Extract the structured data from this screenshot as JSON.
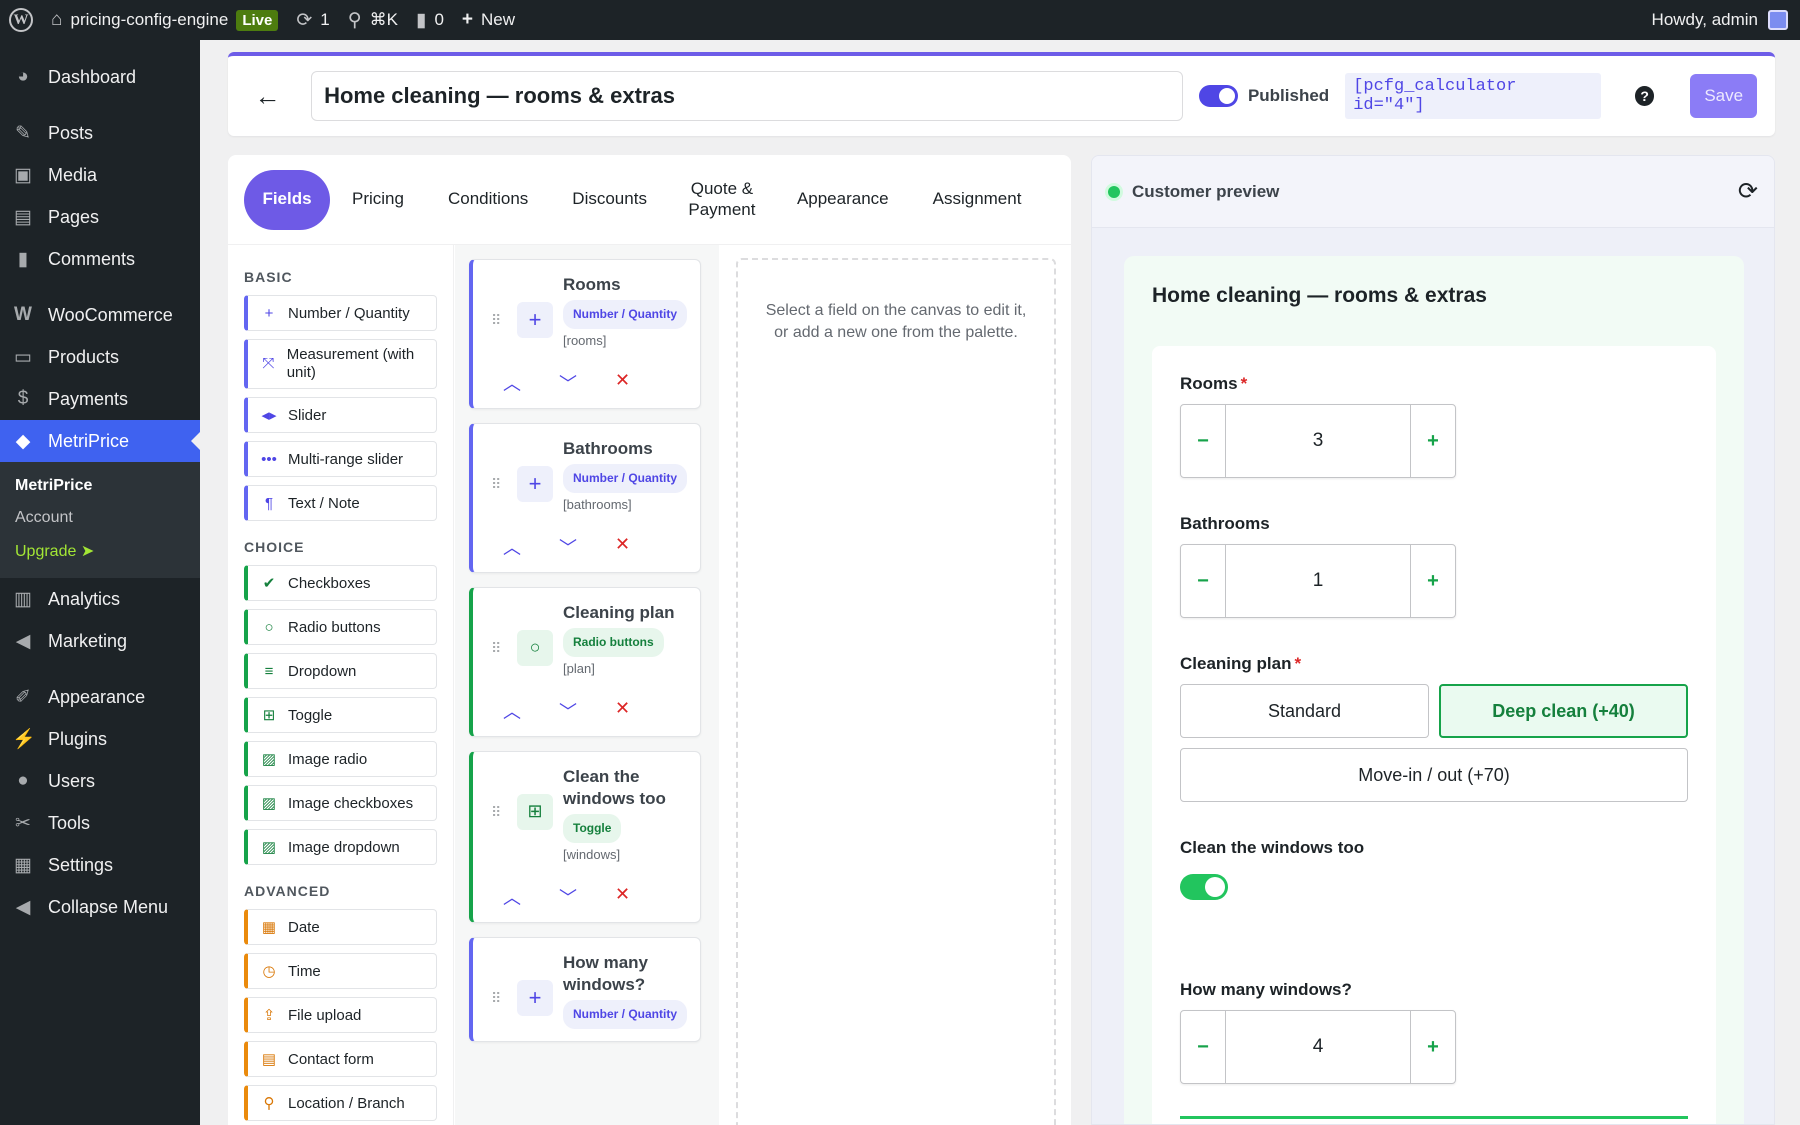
{
  "admin_bar": {
    "site_name": "pricing-config-engine",
    "live_badge": "Live",
    "updates_count": "1",
    "search_shortcut": "⌘K",
    "comments_count": "0",
    "new_label": "New",
    "greeting": "Howdy, admin"
  },
  "sidebar": {
    "items": [
      {
        "label": "Dashboard",
        "icon": "dashboard-icon"
      },
      {
        "label": "Posts",
        "icon": "pin-icon"
      },
      {
        "label": "Media",
        "icon": "media-icon"
      },
      {
        "label": "Pages",
        "icon": "pages-icon"
      },
      {
        "label": "Comments",
        "icon": "comment-icon"
      },
      {
        "label": "WooCommerce",
        "icon": "woo-icon"
      },
      {
        "label": "Products",
        "icon": "products-icon"
      },
      {
        "label": "Payments",
        "icon": "payments-icon"
      },
      {
        "label": "MetriPrice",
        "icon": "metriprice-icon"
      },
      {
        "label": "Analytics",
        "icon": "analytics-icon"
      },
      {
        "label": "Marketing",
        "icon": "megaphone-icon"
      },
      {
        "label": "Appearance",
        "icon": "brush-icon"
      },
      {
        "label": "Plugins",
        "icon": "plugin-icon"
      },
      {
        "label": "Users",
        "icon": "user-icon"
      },
      {
        "label": "Tools",
        "icon": "wrench-icon"
      },
      {
        "label": "Settings",
        "icon": "settings-icon"
      },
      {
        "label": "Collapse Menu",
        "icon": "collapse-icon"
      }
    ],
    "submenu": {
      "current": "MetriPrice",
      "account": "Account",
      "upgrade": "Upgrade ➤"
    }
  },
  "header": {
    "title_value": "Home cleaning — rooms & extras",
    "published_label": "Published",
    "shortcode": "[pcfg_calculator id=\"4\"]",
    "save_label": "Save"
  },
  "tabs": [
    "Fields",
    "Pricing",
    "Conditions",
    "Discounts",
    "Quote & Payment",
    "Appearance",
    "Assignment"
  ],
  "palette": {
    "basic_heading": "BASIC",
    "basic": [
      "Number / Quantity",
      "Measurement (with unit)",
      "Slider",
      "Multi-range slider",
      "Text / Note"
    ],
    "choice_heading": "CHOICE",
    "choice": [
      "Checkboxes",
      "Radio buttons",
      "Dropdown",
      "Toggle",
      "Image radio",
      "Image checkboxes",
      "Image dropdown"
    ],
    "advanced_heading": "ADVANCED",
    "advanced": [
      "Date",
      "Time",
      "File upload",
      "Contact form",
      "Location / Branch"
    ]
  },
  "canvas_fields": [
    {
      "name": "Rooms",
      "type": "Number / Quantity",
      "key": "[rooms]"
    },
    {
      "name": "Bathrooms",
      "type": "Number / Quantity",
      "key": "[bathrooms]"
    },
    {
      "name": "Cleaning plan",
      "type": "Radio buttons",
      "key": "[plan]"
    },
    {
      "name": "Clean the windows too",
      "type": "Toggle",
      "key": "[windows]"
    },
    {
      "name": "How many windows?",
      "type": "Number / Quantity",
      "key": ""
    }
  ],
  "editor_hint": "Select a field on the canvas to edit it, or add a new one from the palette.",
  "preview": {
    "header": "Customer preview",
    "calc_title": "Home cleaning — rooms & extras",
    "rooms_label": "Rooms",
    "rooms_value": "3",
    "bathrooms_label": "Bathrooms",
    "bathrooms_value": "1",
    "plan_label": "Cleaning plan",
    "plan_options": [
      "Standard",
      "Deep clean (+40)",
      "Move-in / out (+70)"
    ],
    "plan_selected": "Deep clean (+40)",
    "windows_toggle_label": "Clean the windows too",
    "windows_toggle_on": true,
    "windows_count_label": "How many windows?",
    "windows_count_value": "4",
    "required_mark": "*",
    "minus": "−",
    "plus": "+"
  },
  "colors": {
    "accent": "#6e5ae6",
    "active_menu": "#3f62f0",
    "success": "#22c55e",
    "danger": "#dc2626"
  }
}
